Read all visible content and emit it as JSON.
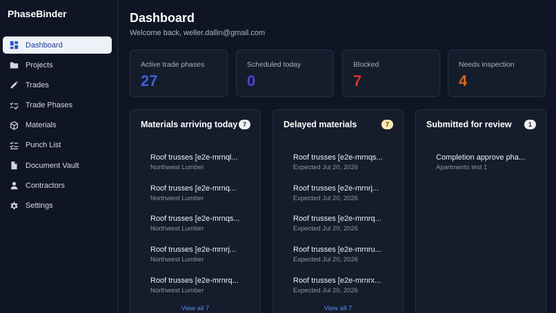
{
  "app": {
    "name": "PhaseBinder"
  },
  "sidebar": {
    "items": [
      {
        "label": "Dashboard",
        "icon": "dashboard-icon"
      },
      {
        "label": "Projects",
        "icon": "folder-icon"
      },
      {
        "label": "Trades",
        "icon": "pencil-icon"
      },
      {
        "label": "Trade Phases",
        "icon": "checklist-icon"
      },
      {
        "label": "Materials",
        "icon": "box-icon"
      },
      {
        "label": "Punch List",
        "icon": "list-check-icon"
      },
      {
        "label": "Document Vault",
        "icon": "document-icon"
      },
      {
        "label": "Contractors",
        "icon": "user-icon"
      },
      {
        "label": "Settings",
        "icon": "gear-icon"
      }
    ],
    "active": "Dashboard"
  },
  "header": {
    "title": "Dashboard",
    "welcome": "Welcome back, weller.dallin@gmail.com"
  },
  "stats": [
    {
      "label": "Active trade phases",
      "value": "27",
      "color": "#3b63d9"
    },
    {
      "label": "Scheduled today",
      "value": "0",
      "color": "#4a46d4"
    },
    {
      "label": "Blocked",
      "value": "7",
      "color": "#d93434"
    },
    {
      "label": "Needs inspection",
      "value": "4",
      "color": "#e0621b"
    }
  ],
  "panels": {
    "arriving": {
      "title": "Materials arriving today",
      "count": "7",
      "items": [
        {
          "title": "Roof trusses [e2e-mrnql...",
          "sub": "Northwest Lumber"
        },
        {
          "title": "Roof trusses [e2e-mrnq...",
          "sub": "Northwest Lumber"
        },
        {
          "title": "Roof trusses [e2e-mrnqs...",
          "sub": "Northwest Lumber"
        },
        {
          "title": "Roof trusses [e2e-mrnrj...",
          "sub": "Northwest Lumber"
        },
        {
          "title": "Roof trusses [e2e-mrnrq...",
          "sub": "Northwest Lumber"
        }
      ],
      "view_all": "View all 7"
    },
    "delayed": {
      "title": "Delayed materials",
      "count": "7",
      "items": [
        {
          "title": "Roof trusses [e2e-mrnqs...",
          "sub": "Expected Jul 20, 2026"
        },
        {
          "title": "Roof trusses [e2e-mrnrj...",
          "sub": "Expected Jul 20, 2026"
        },
        {
          "title": "Roof trusses [e2e-mrnrq...",
          "sub": "Expected Jul 20, 2026"
        },
        {
          "title": "Roof trusses [e2e-mrnru...",
          "sub": "Expected Jul 20, 2026"
        },
        {
          "title": "Roof trusses [e2e-mrnrx...",
          "sub": "Expected Jul 20, 2026"
        }
      ],
      "view_all": "View all 7"
    },
    "review": {
      "title": "Submitted for review",
      "count": "1",
      "items": [
        {
          "title": "Completion approve pha...",
          "sub": "Apartments test 1"
        }
      ]
    }
  }
}
